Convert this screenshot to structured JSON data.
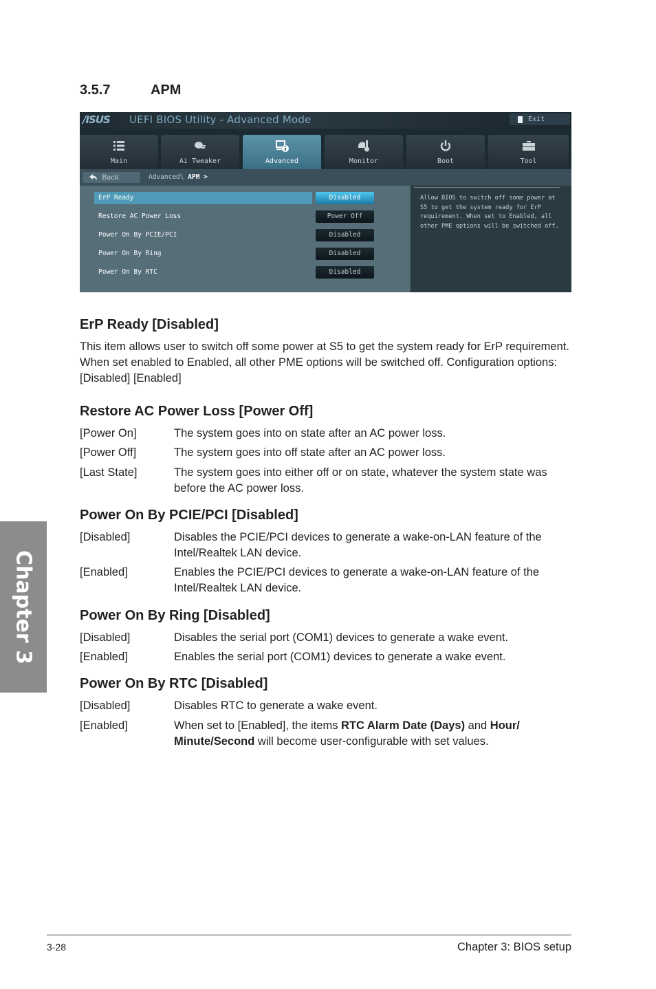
{
  "section": {
    "number": "3.5.7",
    "title": "APM"
  },
  "bios": {
    "logo": "/ISUS",
    "title": "UEFI BIOS Utility - Advanced Mode",
    "exit_label": "Exit",
    "tabs": [
      {
        "label": "Main",
        "icon": "list-icon",
        "active": false
      },
      {
        "label": "Ai Tweaker",
        "icon": "fan-icon",
        "active": false
      },
      {
        "label": "Advanced",
        "icon": "advanced-info-icon",
        "active": true
      },
      {
        "label": "Monitor",
        "icon": "thermometer-icon",
        "active": false
      },
      {
        "label": "Boot",
        "icon": "power-icon",
        "active": false
      },
      {
        "label": "Tool",
        "icon": "toolbox-icon",
        "active": false
      }
    ],
    "back_label": "Back",
    "breadcrumb": {
      "path": "Advanced\\ ",
      "current": "APM >"
    },
    "rows": [
      {
        "label": "ErP Ready",
        "value": "Disabled",
        "selected": true
      },
      {
        "label": "Restore AC Power Loss",
        "value": "Power Off",
        "selected": false
      },
      {
        "label": "Power On By PCIE/PCI",
        "value": "Disabled",
        "selected": false
      },
      {
        "label": "Power On By Ring",
        "value": "Disabled",
        "selected": false
      },
      {
        "label": "Power On By RTC",
        "value": "Disabled",
        "selected": false
      }
    ],
    "help": "Allow BIOS to switch off some power at S5 to get the system ready for ErP requirement. When set to Enabled, all other PME options will be switched off."
  },
  "items": {
    "erp": {
      "title": "ErP Ready [Disabled]",
      "text": "This item allows user to switch off some power at S5 to get the system ready for ErP requirement. When set enabled to Enabled, all other PME options will be switched off. Configuration options: [Disabled] [Enabled]"
    },
    "restore": {
      "title": "Restore AC Power Loss [Power Off]",
      "options": [
        {
          "key": "[Power On]",
          "desc": "The system goes into on state after an AC power loss."
        },
        {
          "key": "[Power Off]",
          "desc": "The system goes into off state after an AC power loss."
        },
        {
          "key": "[Last State]",
          "desc": "The system goes into either off or on state, whatever the system state was before the AC power loss."
        }
      ]
    },
    "pcie": {
      "title": "Power On By PCIE/PCI [Disabled]",
      "options": [
        {
          "key": "[Disabled]",
          "desc": "Disables the PCIE/PCI devices to generate a wake-on-LAN feature of the Intel/Realtek LAN device."
        },
        {
          "key": "[Enabled]",
          "desc": "Enables the PCIE/PCI devices to generate a wake-on-LAN feature of the Intel/Realtek LAN device."
        }
      ]
    },
    "ring": {
      "title": "Power On By Ring [Disabled]",
      "options": [
        {
          "key": "[Disabled]",
          "desc": "Disables the serial port (COM1) devices to generate a wake event."
        },
        {
          "key": "[Enabled]",
          "desc": "Enables the serial port (COM1) devices to generate a wake event."
        }
      ]
    },
    "rtc": {
      "title": "Power On By RTC [Disabled]",
      "options": [
        {
          "key": "[Disabled]",
          "desc": "Disables RTC to generate a wake event."
        },
        {
          "key": "[Enabled]",
          "desc_parts": [
            "When set to [Enabled], the items ",
            "RTC Alarm Date (Days)",
            " and ",
            "Hour/ Minute/Second",
            " will become user-configurable with set values."
          ]
        }
      ]
    }
  },
  "sidebar": {
    "chapter_label": "Chapter 3"
  },
  "footer": {
    "page": "3-28",
    "chapter": "Chapter 3: BIOS setup"
  }
}
